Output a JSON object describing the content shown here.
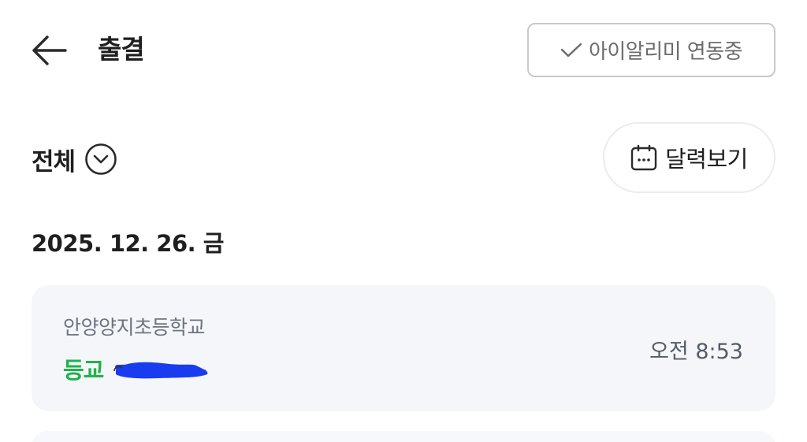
{
  "header": {
    "title": "출결",
    "link_status": "아이알리미 연동중",
    "back_icon": "arrow-left-icon",
    "check_icon": "check-icon"
  },
  "filter": {
    "label": "전체",
    "icon": "chevron-down-circle-icon"
  },
  "calendar_button": {
    "label": "달력보기",
    "icon": "calendar-icon"
  },
  "records": [
    {
      "date": "2025. 12. 26. 금",
      "entries": [
        {
          "school": "안양양지초등학교",
          "status": "등교",
          "time": "오전 8:53"
        }
      ]
    }
  ],
  "colors": {
    "status_green": "#1fb34a",
    "card_background": "#f4f6fa",
    "badge_border": "#c9c9c9",
    "redaction_blue": "#1a3cf0"
  }
}
